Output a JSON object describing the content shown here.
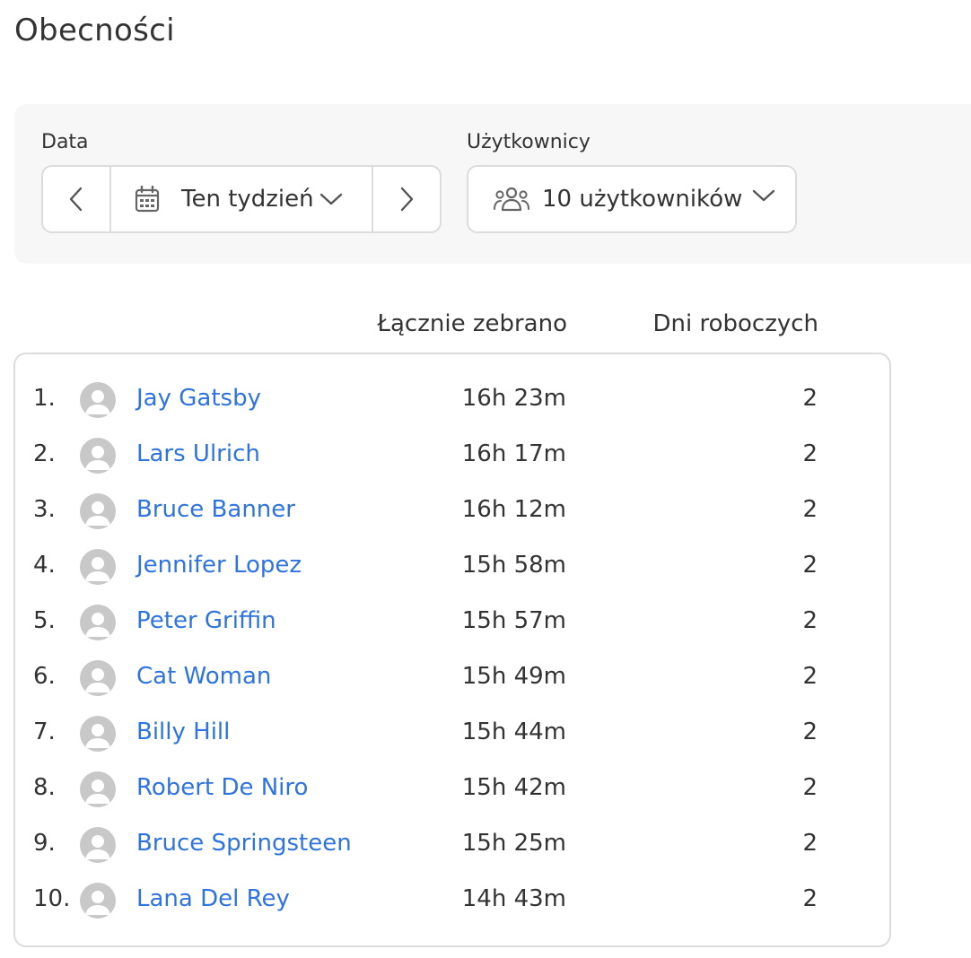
{
  "header": {
    "title": "Obecności"
  },
  "filters": {
    "date_label": "Data",
    "date_value": "Ten tydzień",
    "users_label": "Użytkownicy",
    "users_value": "10 użytkowników"
  },
  "icons": {
    "prev": "chevron-left-icon",
    "next": "chevron-right-icon",
    "calendar": "calendar-icon",
    "users": "users-group-icon",
    "dropdown": "chevron-down-icon",
    "avatar": "avatar-placeholder-icon"
  },
  "colors": {
    "link": "#2f73e0",
    "panel": "#f7f7f7",
    "border": "#dcdcdc",
    "avatar": "#c8c8c8"
  },
  "table": {
    "columns": {
      "total": "Łącznie zebrano",
      "days": "Dni roboczych"
    },
    "rows": [
      {
        "rank": "1.",
        "name": "Jay Gatsby",
        "total": "16h 23m",
        "days": "2"
      },
      {
        "rank": "2.",
        "name": "Lars Ulrich",
        "total": "16h 17m",
        "days": "2"
      },
      {
        "rank": "3.",
        "name": "Bruce Banner",
        "total": "16h 12m",
        "days": "2"
      },
      {
        "rank": "4.",
        "name": "Jennifer Lopez",
        "total": "15h 58m",
        "days": "2"
      },
      {
        "rank": "5.",
        "name": "Peter Griffin",
        "total": "15h 57m",
        "days": "2"
      },
      {
        "rank": "6.",
        "name": "Cat Woman",
        "total": "15h 49m",
        "days": "2"
      },
      {
        "rank": "7.",
        "name": "Billy Hill",
        "total": "15h 44m",
        "days": "2"
      },
      {
        "rank": "8.",
        "name": "Robert De Niro",
        "total": "15h 42m",
        "days": "2"
      },
      {
        "rank": "9.",
        "name": "Bruce Springsteen",
        "total": "15h 25m",
        "days": "2"
      },
      {
        "rank": "10.",
        "name": "Lana Del Rey",
        "total": "14h 43m",
        "days": "2"
      }
    ]
  }
}
